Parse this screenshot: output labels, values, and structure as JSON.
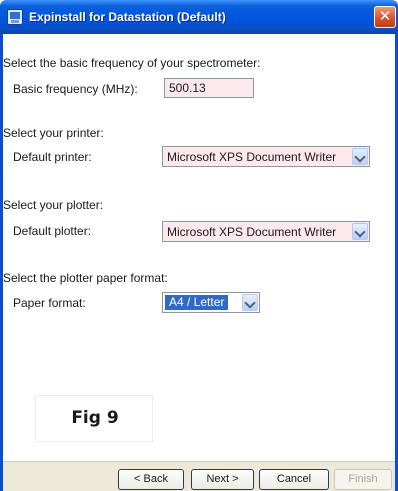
{
  "window": {
    "title": "Expinstall for Datastation (Default)",
    "close_glyph": "✕",
    "icon": "application-icon"
  },
  "frequency": {
    "section_label": "Select the basic frequency of your spectrometer:",
    "field_label": "Basic frequency (MHz):",
    "value": "500.13"
  },
  "printer": {
    "section_label": "Select your printer:",
    "field_label": "Default printer:",
    "value": "Microsoft XPS Document Writer"
  },
  "plotter": {
    "section_label": "Select your plotter:",
    "field_label": "Default plotter:",
    "value": "Microsoft XPS Document Writer"
  },
  "paper": {
    "section_label": "Select the plotter paper format:",
    "field_label": "Paper format:",
    "value": "A4 / Letter"
  },
  "figure_label": "Fig 9",
  "buttons": {
    "back": "< Back",
    "next": "Next >",
    "cancel": "Cancel",
    "finish": "Finish"
  },
  "colors": {
    "title_bar": "#0054e3",
    "field_background": "#fde9ec",
    "selection": "#316ac5",
    "close_button": "#d8512b"
  }
}
